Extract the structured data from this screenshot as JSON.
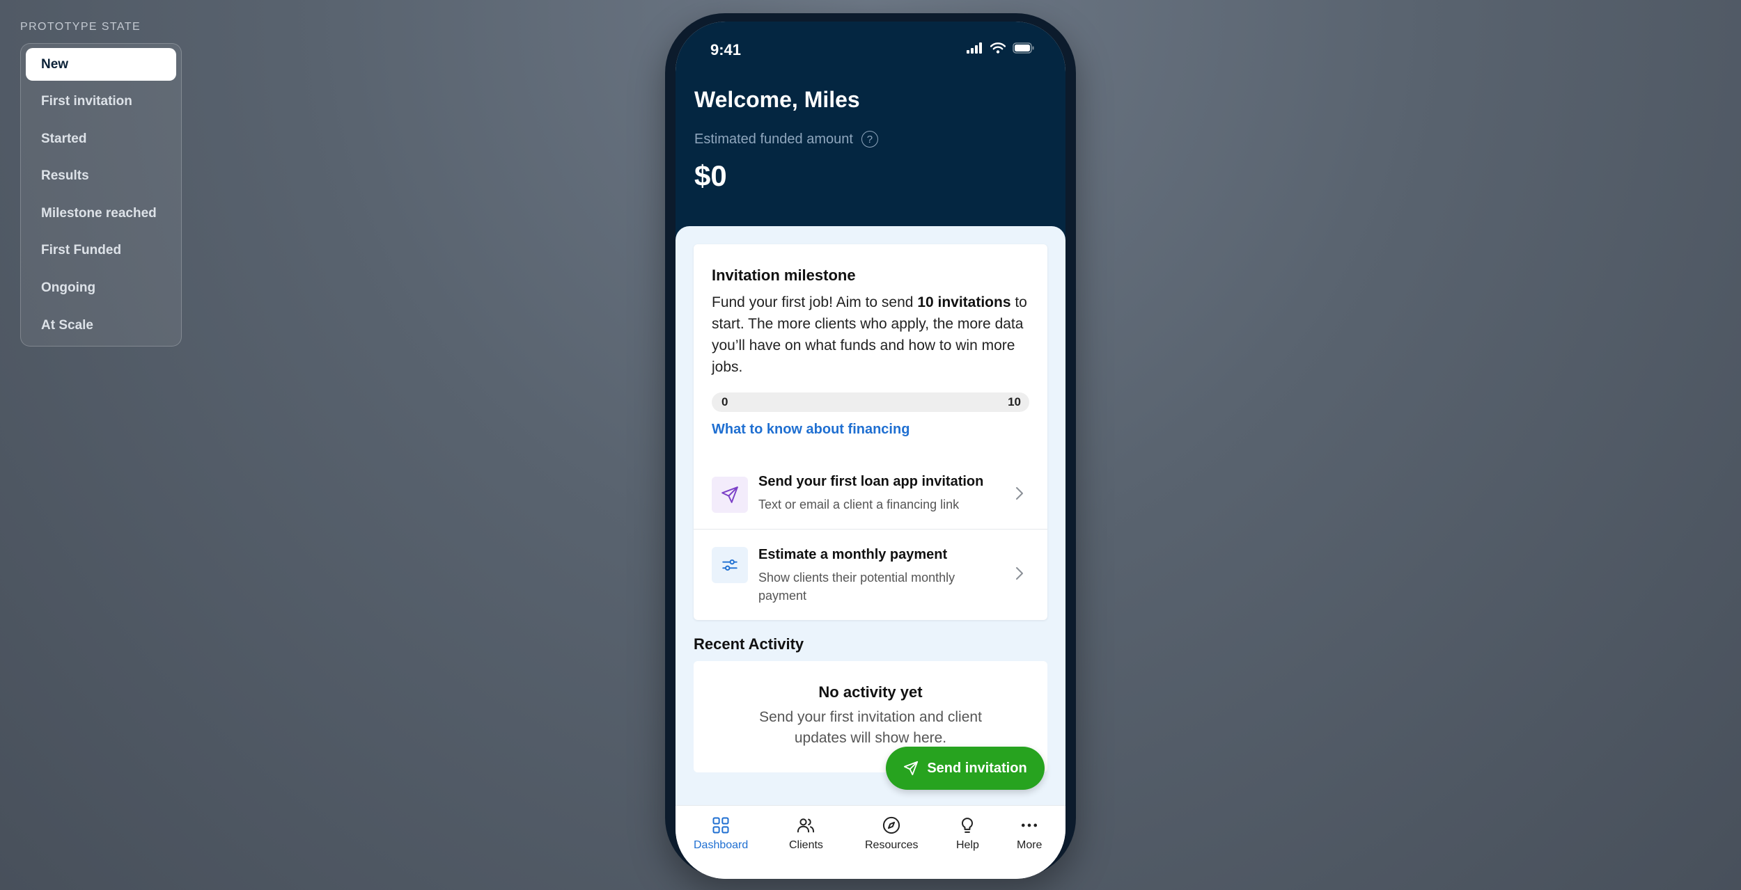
{
  "prototype": {
    "label": "PROTOTYPE STATE",
    "states": [
      "New",
      "First invitation",
      "Started",
      "Results",
      "Milestone reached",
      "First Funded",
      "Ongoing",
      "At Scale"
    ],
    "active_index": 0
  },
  "status_bar": {
    "time": "9:41"
  },
  "header": {
    "welcome": "Welcome, Miles",
    "estimated_label": "Estimated funded amount",
    "help_glyph": "?",
    "amount": "$0"
  },
  "milestone": {
    "title": "Invitation milestone",
    "body_prefix": "Fund your first job! Aim to send ",
    "body_bold": "10 invitations",
    "body_suffix": " to start. The more clients who apply, the more data you’ll have on what funds and how to win more jobs.",
    "progress_min": "0",
    "progress_max": "10",
    "progress_value": 0,
    "link": "What to know about financing"
  },
  "actions": [
    {
      "title": "Send your first loan app invitation",
      "subtitle": "Text or email a client a financing link",
      "icon": "paper-plane-icon"
    },
    {
      "title": "Estimate a monthly payment",
      "subtitle": "Show clients their potential monthly payment",
      "icon": "sliders-icon"
    }
  ],
  "recent": {
    "title": "Recent Activity",
    "empty_title": "No activity yet",
    "empty_text": "Send your first invitation and client updates will show here."
  },
  "fab": {
    "label": "Send invitation"
  },
  "nav": [
    {
      "label": "Dashboard",
      "icon": "grid-icon",
      "active": true
    },
    {
      "label": "Clients",
      "icon": "people-icon"
    },
    {
      "label": "Resources",
      "icon": "compass-icon"
    },
    {
      "label": "Help",
      "icon": "lightbulb-icon"
    },
    {
      "label": "More",
      "icon": "more-dots-icon"
    }
  ],
  "colors": {
    "header_bg": "#042641",
    "accent_blue": "#1f6fd1",
    "fab_green": "#27a31f",
    "plane_purple": "#7b3fc7"
  }
}
